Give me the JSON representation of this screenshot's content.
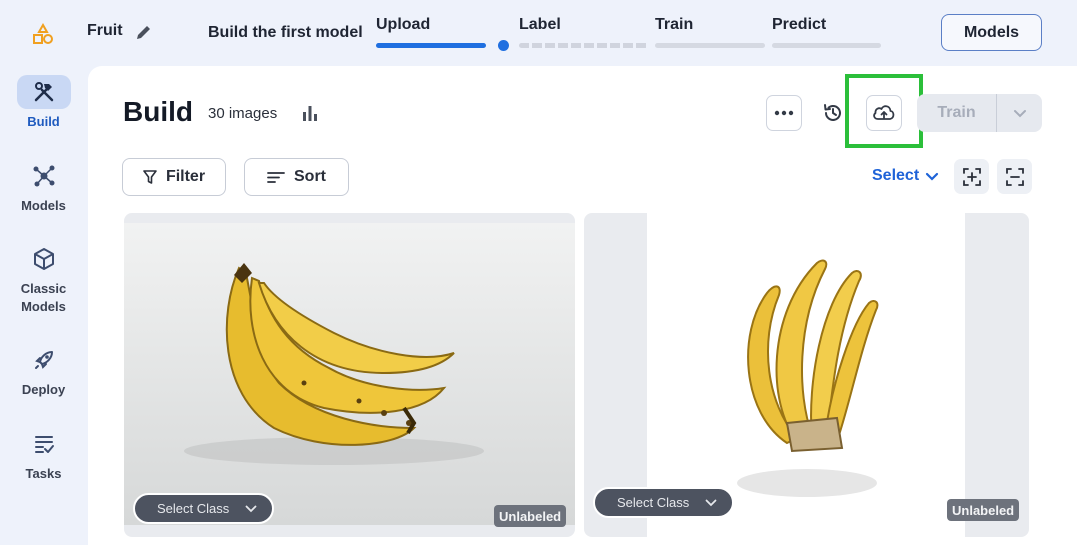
{
  "header": {
    "project_name": "Fruit",
    "model_title": "Build the first model",
    "steps": [
      {
        "label": "Upload",
        "state": "complete"
      },
      {
        "label": "Label",
        "state": "current"
      },
      {
        "label": "Train",
        "state": "pending"
      },
      {
        "label": "Predict",
        "state": "pending"
      }
    ],
    "models_button": "Models"
  },
  "sidebar": {
    "items": [
      {
        "label": "Build",
        "icon": "hammer-wrench-icon",
        "active": true
      },
      {
        "label": "Models",
        "icon": "network-icon",
        "active": false
      },
      {
        "label": "Classic\nModels",
        "icon": "cube-icon",
        "active": false
      },
      {
        "label": "Deploy",
        "icon": "rocket-icon",
        "active": false
      },
      {
        "label": "Tasks",
        "icon": "checklist-icon",
        "active": false
      }
    ]
  },
  "main": {
    "title": "Build",
    "image_count": "30 images",
    "toolbar": {
      "more_icon": "more-horizontal-icon",
      "history_icon": "history-icon",
      "upload_icon": "cloud-upload-icon",
      "train_label": "Train"
    },
    "filter_label": "Filter",
    "sort_label": "Sort",
    "select_label": "Select",
    "cards": [
      {
        "image": "banana-bunch-photo",
        "class_select": "Select Class",
        "badge": "Unlabeled"
      },
      {
        "image": "banana-bunch-photo-2",
        "class_select": "Select Class",
        "badge": "Unlabeled"
      }
    ]
  },
  "colors": {
    "accent": "#1f6fe0",
    "highlight": "#2bbf3a",
    "page_bg": "#eef2fb"
  }
}
